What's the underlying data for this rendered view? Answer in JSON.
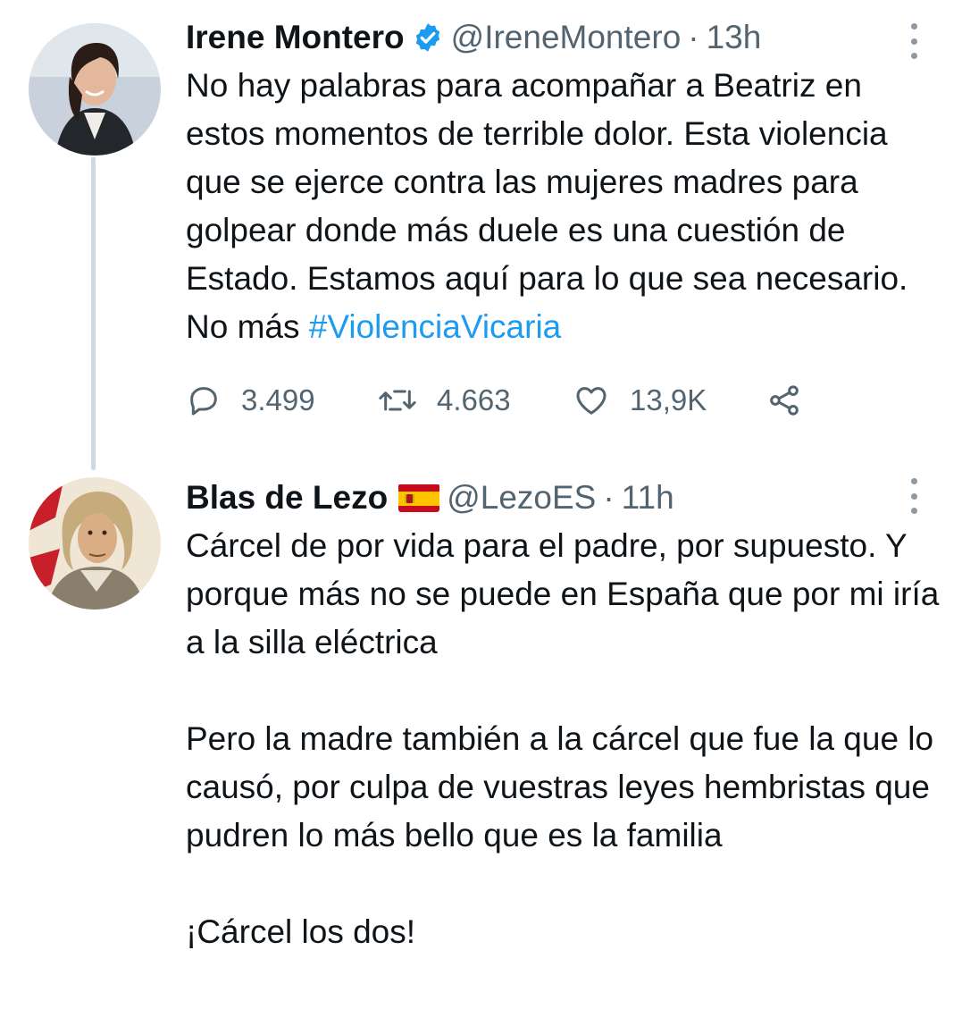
{
  "tweets": [
    {
      "name": "Irene Montero",
      "handle": "@IreneMontero",
      "separator": "·",
      "time": "13h",
      "text_before": "No hay palabras para acompañar a Beatriz en estos momentos de terrible dolor. Esta violencia que se ejerce contra las mujeres madres para golpear donde más duele es una cuestión de Estado. Estamos aquí para lo que sea necesario. No más ",
      "hashtag": "#ViolenciaVicaria",
      "replies": "3.499",
      "retweets": "4.663",
      "likes": "13,9K"
    },
    {
      "name": "Blas de Lezo",
      "handle": "@LezoES",
      "separator": "·",
      "time": "11h",
      "text": "Cárcel de por vida para el padre, por supuesto. Y porque más no se puede en España que por mi iría a la silla eléctrica\n\nPero la madre también a la cárcel que fue la que lo causó, por culpa de vuestras leyes hembristas que pudren lo más bello que es la familia\n\n¡Cárcel los dos!"
    }
  ],
  "colors": {
    "text": "#0f1419",
    "secondary": "#536471",
    "link": "#1d9bf0",
    "verified": "#1d9bf0"
  },
  "icons": [
    "verified-badge-icon",
    "spain-flag-icon",
    "more-icon",
    "reply-icon",
    "retweet-icon",
    "like-icon",
    "share-icon"
  ]
}
